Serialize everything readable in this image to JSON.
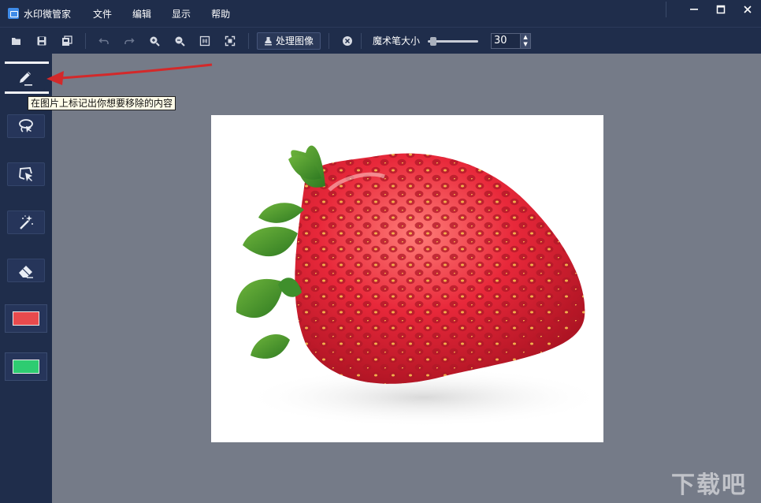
{
  "app": {
    "title": "水印微管家",
    "menu": [
      "文件",
      "编辑",
      "显示",
      "帮助"
    ]
  },
  "window_controls": {
    "minimize_icon": "minimize-icon",
    "maximize_icon": "maximize-icon",
    "close_icon": "close-icon"
  },
  "toolbar": {
    "icons": [
      "open-folder-icon",
      "save-icon",
      "save-as-icon",
      "undo-icon",
      "redo-icon",
      "zoom-in-icon",
      "zoom-out-icon",
      "actual-size-icon",
      "fit-window-icon"
    ],
    "process_label": "处理图像",
    "clear_icon": "clear-circle-icon",
    "brush_size_label": "魔术笔大小",
    "brush_size_level": 0.05,
    "brush_size_value": "30"
  },
  "sidebar": {
    "tools": [
      "pen-tool",
      "lasso-tool",
      "polygon-select-tool",
      "magic-wand-tool",
      "eraser-tool"
    ],
    "colors": {
      "primary": "#e84a4d",
      "secondary": "#2ecc71"
    }
  },
  "tooltip": {
    "text": "在图片上标记出你想要移除的内容"
  },
  "colors": {
    "titlebar": "#1f2d4b",
    "canvas_bg": "#757b88",
    "annotation_arrow": "#d3292a"
  },
  "watermark": {
    "text": "下载吧"
  }
}
